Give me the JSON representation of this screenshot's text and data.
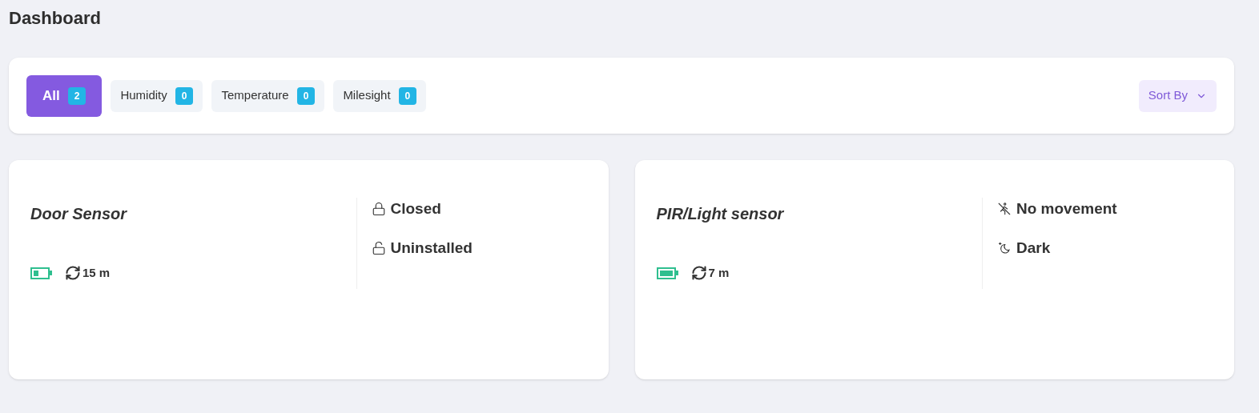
{
  "title": "Dashboard",
  "filters": [
    {
      "label": "All",
      "count": "2",
      "selected": true
    },
    {
      "label": "Humidity",
      "count": "0",
      "selected": false
    },
    {
      "label": "Temperature",
      "count": "0",
      "selected": false
    },
    {
      "label": "Milesight",
      "count": "0",
      "selected": false
    }
  ],
  "sort": {
    "label": "Sort By"
  },
  "devices": [
    {
      "name": "Door Sensor",
      "battery": {
        "kind": "half"
      },
      "interval": "15 m",
      "statuses": [
        {
          "kind": "lock-closed",
          "text": "Closed"
        },
        {
          "kind": "lock-open",
          "text": "Uninstalled"
        }
      ]
    },
    {
      "name": "PIR/Light sensor",
      "battery": {
        "kind": "full"
      },
      "interval": "7 m",
      "statuses": [
        {
          "kind": "no-motion",
          "text": "No movement"
        },
        {
          "kind": "dark",
          "text": "Dark"
        }
      ]
    }
  ]
}
